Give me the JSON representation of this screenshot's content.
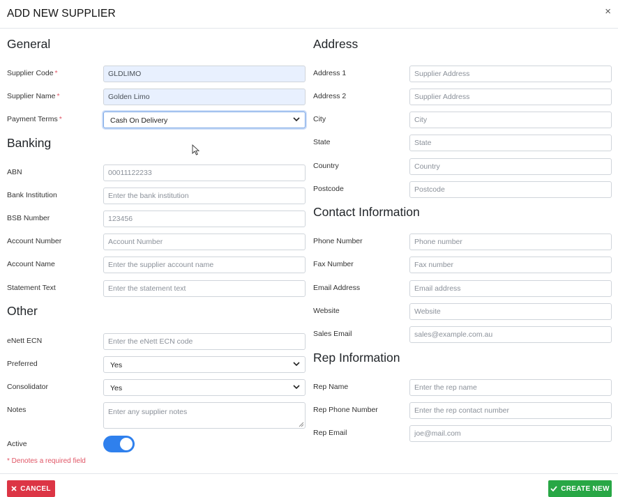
{
  "header": {
    "title": "ADD NEW SUPPLIER",
    "close_symbol": "×"
  },
  "general": {
    "title": "General",
    "supplier_code": {
      "label": "Supplier Code",
      "required": "*",
      "value": "GLDLIMO"
    },
    "supplier_name": {
      "label": "Supplier Name",
      "required": "*",
      "value": "Golden Limo"
    },
    "payment_terms": {
      "label": "Payment Terms",
      "required": "*",
      "value": "Cash On Delivery"
    }
  },
  "banking": {
    "title": "Banking",
    "abn": {
      "label": "ABN",
      "placeholder": "00011122233"
    },
    "bank_institution": {
      "label": "Bank Institution",
      "placeholder": "Enter the bank institution"
    },
    "bsb_number": {
      "label": "BSB Number",
      "placeholder": "123456"
    },
    "account_number": {
      "label": "Account Number",
      "placeholder": "Account Number"
    },
    "account_name": {
      "label": "Account Name",
      "placeholder": "Enter the supplier account name"
    },
    "statement_text": {
      "label": "Statement Text",
      "placeholder": "Enter the statement text"
    }
  },
  "other": {
    "title": "Other",
    "enett_ecn": {
      "label": "eNett ECN",
      "placeholder": "Enter the eNett ECN code"
    },
    "preferred": {
      "label": "Preferred",
      "value": "Yes"
    },
    "consolidator": {
      "label": "Consolidator",
      "value": "Yes"
    },
    "notes": {
      "label": "Notes",
      "placeholder": "Enter any supplier notes"
    },
    "active": {
      "label": "Active",
      "on": true
    }
  },
  "address": {
    "title": "Address",
    "address1": {
      "label": "Address 1",
      "placeholder": "Supplier Address"
    },
    "address2": {
      "label": "Address 2",
      "placeholder": "Supplier Address"
    },
    "city": {
      "label": "City",
      "placeholder": "City"
    },
    "state": {
      "label": "State",
      "placeholder": "State"
    },
    "country": {
      "label": "Country",
      "placeholder": "Country"
    },
    "postcode": {
      "label": "Postcode",
      "placeholder": "Postcode"
    }
  },
  "contact": {
    "title": "Contact Information",
    "phone": {
      "label": "Phone Number",
      "placeholder": "Phone number"
    },
    "fax": {
      "label": "Fax Number",
      "placeholder": "Fax number"
    },
    "email": {
      "label": "Email Address",
      "placeholder": "Email address"
    },
    "website": {
      "label": "Website",
      "placeholder": "Website"
    },
    "sales_email": {
      "label": "Sales Email",
      "placeholder": "sales@example.com.au"
    }
  },
  "rep": {
    "title": "Rep Information",
    "name": {
      "label": "Rep Name",
      "placeholder": "Enter the rep name"
    },
    "phone": {
      "label": "Rep Phone Number",
      "placeholder": "Enter the rep contact number"
    },
    "email": {
      "label": "Rep Email",
      "placeholder": "joe@mail.com"
    }
  },
  "required_note": "* Denotes a required field",
  "footer": {
    "cancel_label": "CANCEL",
    "create_label": "CREATE NEW"
  },
  "colors": {
    "accent": "#2f80ed",
    "danger": "#dc3545",
    "success": "#28a745",
    "required": "#e05565",
    "autofill": "#e8f0fe"
  }
}
